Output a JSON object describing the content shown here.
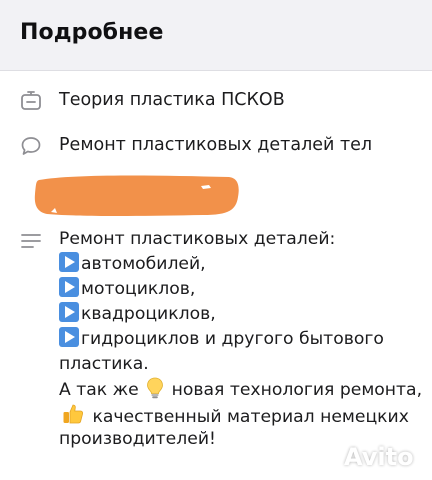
{
  "header": {
    "title": "Подробнее"
  },
  "rows": {
    "category": {
      "icon": "category-icon",
      "text": "Теория пластика ПСКОВ"
    },
    "message": {
      "icon": "speech-bubble-icon",
      "text": "Ремонт пластиковых деталей тел"
    }
  },
  "description": {
    "icon": "text-lines-icon",
    "lines": [
      "Ремонт пластиковых деталей:",
      "автомобилей,",
      "мотоциклов,",
      "квадроциклов,",
      "гидроциклов и другого бытового",
      "пластика.",
      "А так же",
      "новая технология ремонта,",
      "качественный материал немецких",
      "производителей!"
    ]
  },
  "watermark": {
    "brand": "Avito"
  },
  "colors": {
    "header_bg": "#f2f2f5",
    "redaction": "#f2914a",
    "play_icon": "#4a8fe0"
  }
}
